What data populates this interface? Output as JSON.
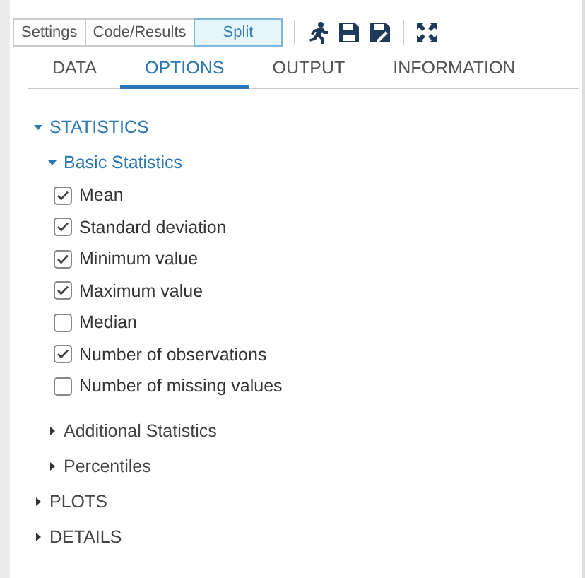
{
  "view_switch": [
    {
      "label": "Settings",
      "selected": false
    },
    {
      "label": "Code/Results",
      "selected": false
    },
    {
      "label": "Split",
      "selected": true
    }
  ],
  "tabs": [
    {
      "label": "DATA",
      "selected": false
    },
    {
      "label": "OPTIONS",
      "selected": true
    },
    {
      "label": "OUTPUT",
      "selected": false
    },
    {
      "label": "INFORMATION",
      "selected": false
    }
  ],
  "sections": [
    {
      "label": "STATISTICS",
      "expanded": true,
      "subsections": [
        {
          "label": "Basic Statistics",
          "expanded": true,
          "options": [
            {
              "label": "Mean",
              "checked": true
            },
            {
              "label": "Standard deviation",
              "checked": true
            },
            {
              "label": "Minimum value",
              "checked": true
            },
            {
              "label": "Maximum value",
              "checked": true
            },
            {
              "label": "Median",
              "checked": false
            },
            {
              "label": "Number of observations",
              "checked": true
            },
            {
              "label": "Number of missing values",
              "checked": false
            }
          ]
        },
        {
          "label": "Additional Statistics",
          "expanded": false
        },
        {
          "label": "Percentiles",
          "expanded": false
        }
      ]
    },
    {
      "label": "PLOTS",
      "expanded": false
    },
    {
      "label": "DETAILS",
      "expanded": false
    }
  ]
}
